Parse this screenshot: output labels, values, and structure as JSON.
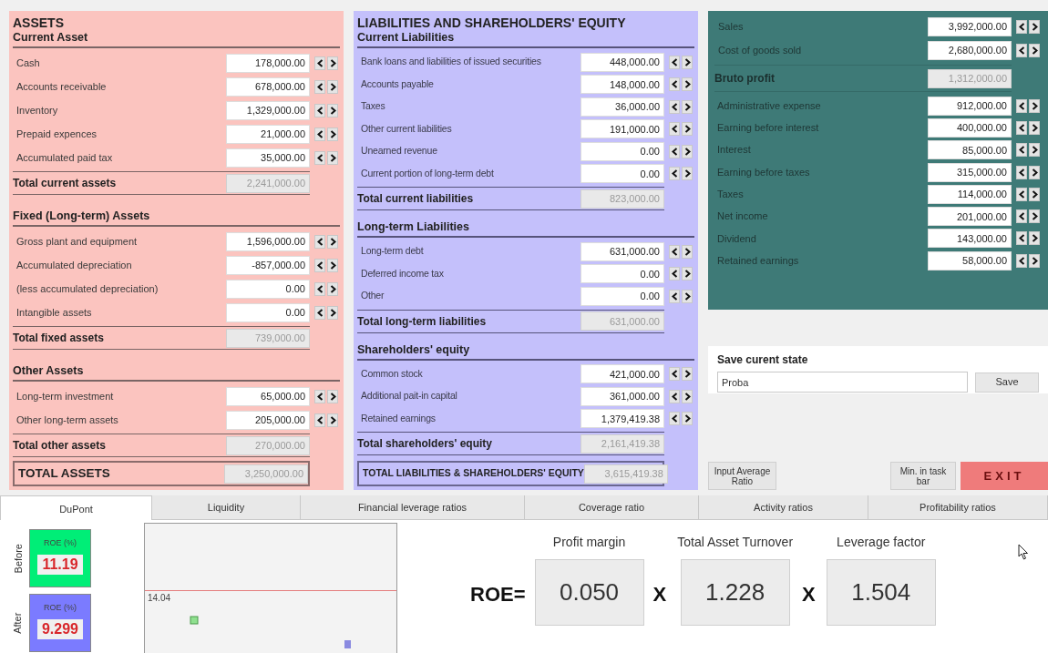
{
  "assets": {
    "title": "ASSETS",
    "sections": [
      {
        "heading": "Current Asset",
        "rows": [
          {
            "label": "Cash",
            "value": "178,000.00"
          },
          {
            "label": "Accounts receivable",
            "value": "678,000.00"
          },
          {
            "label": "Inventory",
            "value": "1,329,000.00"
          },
          {
            "label": "Prepaid expences",
            "value": "21,000.00"
          },
          {
            "label": "Accumulated paid tax",
            "value": "35,000.00"
          }
        ],
        "total": {
          "label": "Total current assets",
          "value": "2,241,000.00"
        }
      },
      {
        "heading": "Fixed (Long-term) Assets",
        "rows": [
          {
            "label": "Gross plant and equipment",
            "value": "1,596,000.00"
          },
          {
            "label": "Accumulated depreciation",
            "value": "-857,000.00"
          },
          {
            "label": "(less accumulated depreciation)",
            "value": "0.00"
          },
          {
            "label": "Intangible assets",
            "value": "0.00"
          }
        ],
        "total": {
          "label": "Total fixed assets",
          "value": "739,000.00"
        }
      },
      {
        "heading": "Other Assets",
        "rows": [
          {
            "label": "Long-term investment",
            "value": "65,000.00"
          },
          {
            "label": "Other long-term assets",
            "value": "205,000.00"
          }
        ],
        "total": {
          "label": "Total other assets",
          "value": "270,000.00"
        }
      }
    ],
    "grand_total": {
      "label": "TOTAL ASSETS",
      "value": "3,250,000.00"
    }
  },
  "liabilities": {
    "title": "LIABILITIES AND SHAREHOLDERS' EQUITY",
    "sections": [
      {
        "heading": "Current Liabilities",
        "rows": [
          {
            "label": "Bank loans and liabilities of issued securities",
            "value": "448,000.00"
          },
          {
            "label": "Accounts payable",
            "value": "148,000.00"
          },
          {
            "label": "Taxes",
            "value": "36,000.00"
          },
          {
            "label": "Other current liabilities",
            "value": "191,000.00"
          },
          {
            "label": "Unearned revenue",
            "value": "0.00"
          },
          {
            "label": "Current portion of long-term debt",
            "value": "0.00"
          }
        ],
        "total": {
          "label": "Total current liabilities",
          "value": "823,000.00"
        }
      },
      {
        "heading": "Long-term Liabilities",
        "rows": [
          {
            "label": "Long-term debt",
            "value": "631,000.00"
          },
          {
            "label": "Deferred income tax",
            "value": "0.00"
          },
          {
            "label": "Other",
            "value": "0.00"
          }
        ],
        "total": {
          "label": "Total long-term liabilities",
          "value": "631,000.00"
        }
      },
      {
        "heading": "Shareholders' equity",
        "rows": [
          {
            "label": "Common stock",
            "value": "421,000.00"
          },
          {
            "label": "Additional pait-in capital",
            "value": "361,000.00"
          },
          {
            "label": "Retained earnings",
            "value": "1,379,419.38"
          }
        ],
        "total": {
          "label": "Total shareholders' equity",
          "value": "2,161,419.38"
        }
      }
    ],
    "grand_total": {
      "label": "TOTAL LIABILITIES & SHAREHOLDERS' EQUITY",
      "value": "3,615,419.38"
    }
  },
  "income": {
    "rows": [
      {
        "kind": "input",
        "label": "Sales",
        "value": "3,992,000.00"
      },
      {
        "kind": "input",
        "label": "Cost of goods sold",
        "value": "2,680,000.00"
      },
      {
        "kind": "total",
        "label": "Bruto profit",
        "value": "1,312,000.00"
      },
      {
        "kind": "input",
        "label": "Administrative expense",
        "value": "912,000.00"
      },
      {
        "kind": "input",
        "label": "Earning before interest",
        "value": "400,000.00"
      },
      {
        "kind": "input",
        "label": "Interest",
        "value": "85,000.00"
      },
      {
        "kind": "input",
        "label": "Earning before taxes",
        "value": "315,000.00"
      },
      {
        "kind": "input",
        "label": "Taxes",
        "value": "114,000.00"
      },
      {
        "kind": "input",
        "label": "Net income",
        "value": "201,000.00"
      },
      {
        "kind": "input",
        "label": "Dividend",
        "value": "143,000.00"
      },
      {
        "kind": "input",
        "label": "Retained earnings",
        "value": "58,000.00"
      }
    ]
  },
  "save": {
    "heading": "Save curent state",
    "value": "Proba",
    "button": "Save"
  },
  "actions": {
    "input_average": "Input Average Ratio",
    "minimize": "Min. in task bar",
    "exit": "EXIT"
  },
  "tabs": [
    {
      "label": "DuPont",
      "selected": true
    },
    {
      "label": "Liquidity",
      "selected": false
    },
    {
      "label": "Financial leverage ratios",
      "selected": false
    },
    {
      "label": "Coverage ratio",
      "selected": false
    },
    {
      "label": "Activity ratios",
      "selected": false
    },
    {
      "label": "Profitability ratios",
      "selected": false
    }
  ],
  "dupont": {
    "scores": [
      {
        "label": "Before",
        "title": "ROE (%)",
        "value": "11.19",
        "color": "#00ee77"
      },
      {
        "label": "After",
        "title": "ROE (%)",
        "value": "9.299",
        "color": "#7b7bff"
      }
    ],
    "chart_label": "14.04",
    "formula": {
      "lead": "ROE=",
      "factors": [
        {
          "label": "Profit margin",
          "value": "0.050"
        },
        {
          "operator": "X",
          "label": "Total Asset Turnover",
          "value": "1.228"
        },
        {
          "operator": "X",
          "label": "Leverage factor",
          "value": "1.504"
        }
      ]
    }
  }
}
